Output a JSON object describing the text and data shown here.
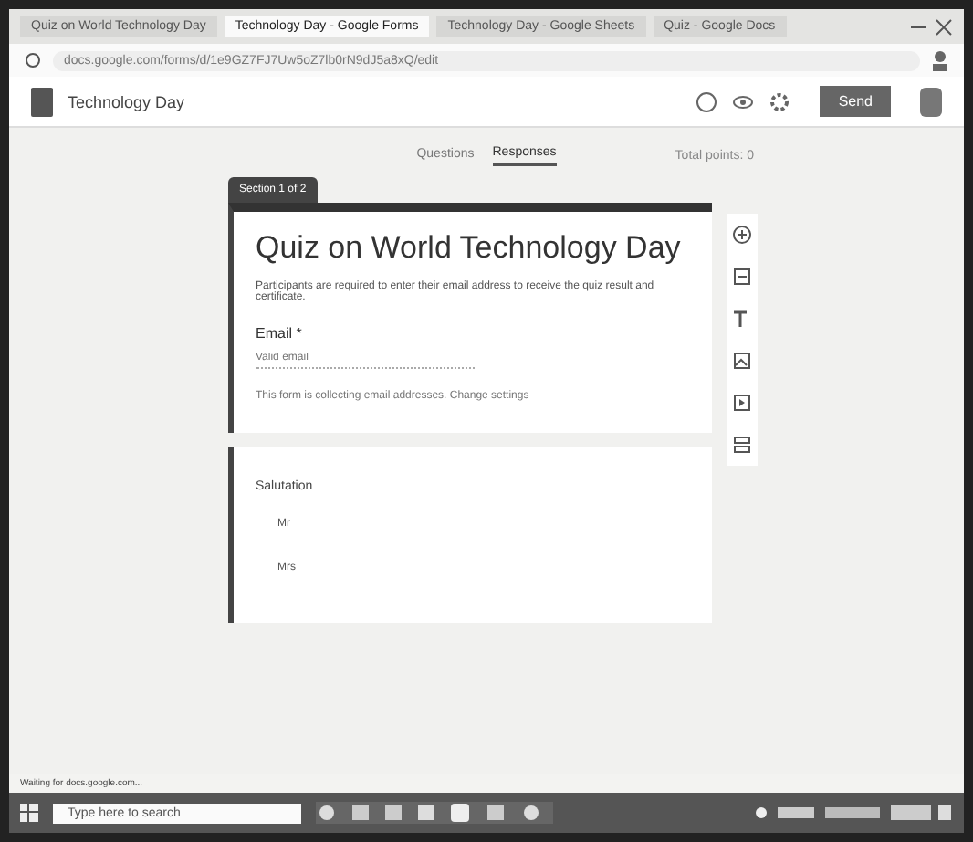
{
  "browser": {
    "tabs": [
      {
        "title": "Quiz on World Technology Day",
        "selected": false
      },
      {
        "title": "Technology Day - Google Forms",
        "selected": true
      },
      {
        "title": "Technology Day - Google Sheets",
        "selected": false
      },
      {
        "title": "Quiz - Google Docs",
        "selected": false
      }
    ],
    "url": "docs.google.com/forms/d/1e9GZ7FJ7Uw5oZ7lb0rN9dJ5a8xQ/edit"
  },
  "form_header": {
    "title": "Technology Day",
    "send_button": "Send"
  },
  "view_tabs": [
    {
      "label": "Questions",
      "selected": false
    },
    {
      "label": "Responses",
      "selected": true
    }
  ],
  "total_points": "Total points: 0",
  "section_label": "Section 1 of 2",
  "form_card": {
    "title": "Quiz on World Technology Day",
    "description": "Participants are required to enter their email address to receive the quiz result and certificate.",
    "email_label": "Email *",
    "email_placeholder": "Valid email",
    "email_note": "This form is collecting email addresses. Change settings"
  },
  "question_card": {
    "title": "Salutation",
    "options": [
      {
        "label": "Mr"
      },
      {
        "label": "Mrs"
      }
    ]
  },
  "status_text": "Waiting for docs.google.com...",
  "taskbar": {
    "search_placeholder": "Type here to search"
  }
}
